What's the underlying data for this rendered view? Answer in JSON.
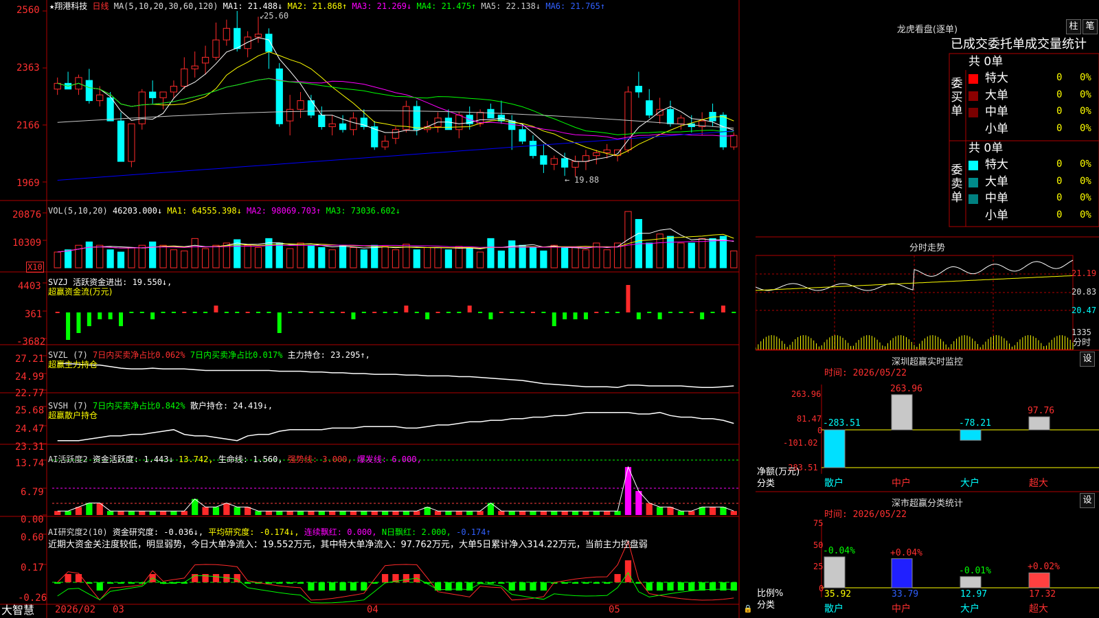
{
  "colors": {
    "up": "#ff2a2a",
    "down": "#00ffff",
    "ma1": "#ffffff",
    "ma2": "#ffff00",
    "ma3": "#ff00ff",
    "ma4": "#00ff00",
    "ma5": "#c8c8c8",
    "ma6": "#0000ff",
    "frame": "#b00000"
  },
  "kline": {
    "header": {
      "name": "★翔港科技",
      "period": "日线",
      "ma_params": "MA(5,10,20,30,60,120)",
      "ma1": "MA1: 21.488↓",
      "ma2": "MA2: 21.868↑",
      "ma3": "MA3: 21.269↓",
      "ma4": "MA4: 21.475↑",
      "ma5": "MA5: 22.138↓",
      "ma6": "MA6: 21.765↑"
    },
    "yaxis": [
      "2560",
      "2363",
      "2166",
      "1969"
    ],
    "high_label": "25.60",
    "low_label": "19.88",
    "candles": [
      [
        22.9,
        23.3,
        22.7,
        23.1
      ],
      [
        23.1,
        23.5,
        22.9,
        22.9
      ],
      [
        22.9,
        23.4,
        22.7,
        23.3
      ],
      [
        23.2,
        23.6,
        22.4,
        22.5
      ],
      [
        22.5,
        23.0,
        22.3,
        22.7
      ],
      [
        22.6,
        22.8,
        21.8,
        21.8
      ],
      [
        21.8,
        22.1,
        20.4,
        20.4
      ],
      [
        20.4,
        21.7,
        20.2,
        21.7
      ],
      [
        21.7,
        22.9,
        21.5,
        22.8
      ],
      [
        22.8,
        23.2,
        22.4,
        22.6
      ],
      [
        22.6,
        22.8,
        22.2,
        22.8
      ],
      [
        22.8,
        23.2,
        22.6,
        23.0
      ],
      [
        23.0,
        24.0,
        22.9,
        23.6
      ],
      [
        23.6,
        24.2,
        23.3,
        23.7
      ],
      [
        23.8,
        24.4,
        23.4,
        24.0
      ],
      [
        24.0,
        25.2,
        23.9,
        24.6
      ],
      [
        24.6,
        25.3,
        24.4,
        25.0
      ],
      [
        25.0,
        25.6,
        24.2,
        24.3
      ],
      [
        24.3,
        24.9,
        24.0,
        24.7
      ],
      [
        24.7,
        25.4,
        24.5,
        24.8
      ],
      [
        24.8,
        25.0,
        23.6,
        24.2
      ],
      [
        23.6,
        23.8,
        21.6,
        21.7
      ],
      [
        21.8,
        22.7,
        21.3,
        22.2
      ],
      [
        22.2,
        22.8,
        21.9,
        22.5
      ],
      [
        22.5,
        22.7,
        21.9,
        22.0
      ],
      [
        22.0,
        22.3,
        21.5,
        21.6
      ],
      [
        21.6,
        22.0,
        21.3,
        21.7
      ],
      [
        21.7,
        22.0,
        21.4,
        21.5
      ],
      [
        21.5,
        22.1,
        21.3,
        21.9
      ],
      [
        21.9,
        22.2,
        21.5,
        21.6
      ],
      [
        21.6,
        21.8,
        20.8,
        20.9
      ],
      [
        20.9,
        21.3,
        20.8,
        21.1
      ],
      [
        21.2,
        21.6,
        21.0,
        21.5
      ],
      [
        21.5,
        22.5,
        21.4,
        22.3
      ],
      [
        22.3,
        22.5,
        21.3,
        21.5
      ],
      [
        21.5,
        21.8,
        21.4,
        21.6
      ],
      [
        21.6,
        22.1,
        21.4,
        21.9
      ],
      [
        21.9,
        22.2,
        21.5,
        21.5
      ],
      [
        21.5,
        22.1,
        21.2,
        22.0
      ],
      [
        22.0,
        22.3,
        21.5,
        21.7
      ],
      [
        21.7,
        22.2,
        21.6,
        22.1
      ],
      [
        22.2,
        22.4,
        21.9,
        21.9
      ],
      [
        22.0,
        22.5,
        21.7,
        21.8
      ],
      [
        21.8,
        22.0,
        20.8,
        21.5
      ],
      [
        21.5,
        21.7,
        21.0,
        21.1
      ],
      [
        21.1,
        21.3,
        20.5,
        20.6
      ],
      [
        20.6,
        21.0,
        20.0,
        20.3
      ],
      [
        20.3,
        20.6,
        20.1,
        20.5
      ],
      [
        20.5,
        20.7,
        19.9,
        20.2
      ],
      [
        20.2,
        20.6,
        19.88,
        20.4
      ],
      [
        20.4,
        20.8,
        20.1,
        20.6
      ],
      [
        20.6,
        20.8,
        20.3,
        20.7
      ],
      [
        20.7,
        21.0,
        20.5,
        20.8
      ],
      [
        20.6,
        20.8,
        20.4,
        20.8
      ],
      [
        20.8,
        23.0,
        20.7,
        22.8
      ],
      [
        23.0,
        23.5,
        22.6,
        22.8
      ],
      [
        22.5,
        22.9,
        21.9,
        22.0
      ],
      [
        22.0,
        22.6,
        21.7,
        22.2
      ],
      [
        22.2,
        22.5,
        21.6,
        21.7
      ],
      [
        21.7,
        22.0,
        21.5,
        21.9
      ],
      [
        21.7,
        22.0,
        21.4,
        21.6
      ],
      [
        21.6,
        22.1,
        21.3,
        21.8
      ],
      [
        22.1,
        22.4,
        21.6,
        21.8
      ],
      [
        22.0,
        22.1,
        20.8,
        20.9
      ],
      [
        20.9,
        21.4,
        20.8,
        21.3
      ]
    ],
    "xaxis": {
      "year_month": "2026/02",
      "m3": "03",
      "m4": "04",
      "m5": "05"
    }
  },
  "volume": {
    "header": "VOL(5,10,20)",
    "value": "46203.000↓",
    "ma1": "MA1: 64555.398↓",
    "ma2": "MA2: 98069.703↑",
    "ma3": "MA3: 73036.602↓",
    "yaxis": [
      "20876",
      "10309"
    ],
    "unit": "X10",
    "values": [
      14,
      16,
      20,
      23,
      20,
      16,
      14,
      18,
      20,
      23,
      20,
      16,
      15,
      26,
      17,
      20,
      22,
      25,
      20,
      18,
      26,
      22,
      17,
      22,
      20,
      18,
      16,
      20,
      18,
      16,
      20,
      19,
      16,
      21,
      16,
      18,
      18,
      16,
      19,
      17,
      14,
      26,
      15,
      24,
      20,
      18,
      15,
      20,
      18,
      18,
      16,
      22,
      16,
      22,
      50,
      43,
      22,
      30,
      28,
      22,
      22,
      26,
      26,
      28,
      15
    ]
  },
  "svzj": {
    "header": "SVZJ  活跃资金进出: 19.550↓,",
    "subtitle": "超赢资金流(万元)",
    "yaxis": [
      "4403",
      "361",
      "-3682"
    ],
    "values": [
      0,
      -4,
      -3,
      -2,
      -1,
      -1,
      -2,
      0,
      0,
      -1,
      0,
      0,
      0,
      0,
      0,
      1,
      0,
      0,
      0,
      0,
      0,
      -3,
      0,
      0,
      0,
      0,
      0,
      0,
      -1,
      0,
      0,
      0,
      0,
      1,
      0,
      -1,
      0,
      0,
      0,
      1,
      0,
      -1,
      0,
      0,
      0,
      0,
      0,
      -2,
      -1,
      -1,
      -1,
      0,
      0,
      0,
      4,
      -1,
      0,
      -1,
      0,
      0,
      0,
      -1,
      0,
      1,
      0
    ]
  },
  "svzl": {
    "header_name": "SVZL (7)",
    "buy_ratio": "7日内买卖净占比0.062%",
    "net_ratio": "7日内买卖净占比0.017%",
    "main_label": "主力持仓: 23.295↑,",
    "subtitle": "超赢主力持仓",
    "yaxis": [
      "27.21",
      "24.99",
      "22.77"
    ],
    "line": [
      26.2,
      26.2,
      26.1,
      26.0,
      26.0,
      25.8,
      25.6,
      25.5,
      25.5,
      25.6,
      25.5,
      25.5,
      25.5,
      25.4,
      25.3,
      25.3,
      25.3,
      25.3,
      25.3,
      25.3,
      25.3,
      25.2,
      25.2,
      25.2,
      25.1,
      25.1,
      25.0,
      25.0,
      24.9,
      24.9,
      24.8,
      24.8,
      24.8,
      24.7,
      24.7,
      24.6,
      24.6,
      24.6,
      24.5,
      24.5,
      24.4,
      24.3,
      24.2,
      24.1,
      24.0,
      23.8,
      23.6,
      23.5,
      23.4,
      23.3,
      23.2,
      23.2,
      23.2,
      23.1,
      23.4,
      23.4,
      23.3,
      23.3,
      23.3,
      23.3,
      23.2,
      23.1,
      23.1,
      23.2,
      23.3
    ]
  },
  "svsh": {
    "header_name": "SVSH (7)",
    "ratio": "7日内买卖净占比0.842%",
    "retail_label": "散户持仓: 24.419↓,",
    "subtitle": "超赢散户持仓",
    "yaxis": [
      "25.68",
      "24.47",
      "23.31"
    ],
    "line": [
      23.5,
      23.5,
      23.5,
      23.6,
      23.7,
      23.8,
      23.8,
      23.9,
      23.9,
      24.0,
      24.1,
      24.2,
      23.9,
      23.8,
      23.8,
      23.7,
      23.6,
      23.5,
      23.8,
      23.9,
      23.9,
      24.1,
      24.2,
      24.2,
      24.2,
      24.2,
      24.3,
      24.3,
      24.3,
      24.4,
      24.4,
      24.4,
      24.4,
      24.3,
      24.3,
      24.4,
      24.5,
      24.5,
      24.6,
      24.7,
      24.7,
      24.8,
      24.8,
      24.9,
      24.9,
      25.0,
      25.0,
      25.1,
      25.1,
      25.2,
      25.3,
      25.3,
      25.3,
      25.3,
      25.3,
      25.2,
      25.2,
      25.3,
      25.1,
      25.0,
      25.0,
      24.9,
      24.9,
      24.8,
      24.6
    ]
  },
  "ai_active": {
    "header": "AI活跃度2",
    "active": "资金活跃度: 1.443↓",
    "ma": "13.742,",
    "life": "生命线: 1.560,",
    "strong": "强势线: 3.000,",
    "burst": "爆发线: 6.000,",
    "yaxis": [
      "13.74",
      "6.79",
      "0.00"
    ],
    "values": [
      1,
      1,
      2,
      3,
      3,
      1,
      1,
      1,
      1,
      1,
      1,
      1,
      1,
      4,
      2,
      2,
      3,
      2,
      2,
      1,
      1,
      1,
      1,
      1,
      1,
      1,
      1,
      1,
      1,
      1,
      1,
      1,
      1,
      1,
      1,
      2,
      1,
      1,
      1,
      1,
      1,
      3,
      1,
      1,
      1,
      1,
      1,
      1,
      1,
      1,
      1,
      1,
      1,
      1,
      12,
      6,
      3,
      2,
      2,
      1,
      1,
      2,
      2,
      2,
      1
    ]
  },
  "ai_research": {
    "header": "AI研究度2(10)",
    "research": "资金研究度: -0.036↓,",
    "avg": "平均研究度: -0.174↓,",
    "red": "连续飘红: 0.000,",
    "nred": "N日飘红: 2.000,",
    "last": "-0.174↑",
    "comment": "近期大资金关注度较低，明显弱势，今日大单净流入：19.552万元，其中特大单净流入：97.762万元，大单5日累计净入314.22万元，当前主力控盘弱",
    "yaxis": [
      "0.60",
      "0.17",
      "-0.26"
    ],
    "values": [
      0,
      1,
      1,
      0,
      -1,
      0,
      0,
      0,
      0,
      1,
      0,
      0,
      0,
      1,
      1,
      1,
      1,
      1,
      0,
      0,
      0,
      0,
      0,
      0,
      -1,
      -1,
      -1,
      -1,
      -1,
      -1,
      0,
      1,
      1,
      1,
      1,
      0,
      -1,
      -1,
      -1,
      -1,
      0,
      0,
      0,
      -1,
      -1,
      -1,
      -1,
      0,
      0,
      0,
      0,
      0,
      0,
      1,
      3,
      0,
      -1,
      -1,
      -1,
      -1,
      -1,
      -1,
      -1,
      -1,
      -1
    ]
  },
  "bottom_bar": {
    "label": "大智慧"
  },
  "panel": {
    "title": "龙虎看盘(逐单)",
    "btn_bar": "柱",
    "btn_pen": "笔",
    "subtitle": "已成交委托单成交量统计",
    "buy_label": "委买单",
    "sell_label": "委卖单",
    "buy_total": "共 0单",
    "sell_total": "共 0单",
    "rows": [
      "特大",
      "大单",
      "中单",
      "小单"
    ],
    "row_value": "0",
    "row_pct": "0%"
  },
  "minute": {
    "title": "分时走势",
    "yaxis": [
      "21.19",
      "20.83",
      "20.47"
    ],
    "vol_label": "1335",
    "period": "分时"
  },
  "sz_monitor": {
    "title": "深圳超赢实时监控",
    "btn": "设",
    "time": "时间: 2026/05/22",
    "yaxis": [
      "263.96",
      "81.47",
      "0",
      "-101.02",
      "-283.51"
    ],
    "ylabel": "净额(万元)",
    "xlabel": "分类",
    "categories": [
      "散户",
      "中户",
      "大户",
      "超大"
    ],
    "values": [
      -283.51,
      263.96,
      -78.21,
      97.76
    ],
    "value_labels": [
      "-283.51",
      "263.96",
      "-78.21",
      "97.76"
    ]
  },
  "sz_stats": {
    "title": "深市超赢分类统计",
    "btn": "设",
    "time": "时间: 2026/05/22",
    "yaxis": [
      "75",
      "50",
      "25",
      "0"
    ],
    "ylabel": "比例%",
    "xlabel": "分类",
    "categories": [
      "散户",
      "中户",
      "大户",
      "超大"
    ],
    "values": [
      35.92,
      33.79,
      12.97,
      17.32
    ],
    "value_labels": [
      "35.92",
      "33.79",
      "12.97",
      "17.32"
    ],
    "change_labels": [
      "-0.04%",
      "+0.04%",
      "-0.01%",
      "+0.02%"
    ]
  },
  "chart_data": [
    {
      "type": "bar",
      "title": "深圳超赢实时监控",
      "ylabel": "净额(万元)",
      "xlabel": "分类",
      "categories": [
        "散户",
        "中户",
        "大户",
        "超大"
      ],
      "values": [
        -283.51,
        263.96,
        -78.21,
        97.76
      ],
      "ylim": [
        -283.51,
        263.96
      ]
    },
    {
      "type": "bar",
      "title": "深市超赢分类统计",
      "ylabel": "比例%",
      "xlabel": "分类",
      "categories": [
        "散户",
        "中户",
        "大户",
        "超大"
      ],
      "values": [
        35.92,
        33.79,
        12.97,
        17.32
      ],
      "ylim": [
        0,
        75
      ]
    }
  ]
}
